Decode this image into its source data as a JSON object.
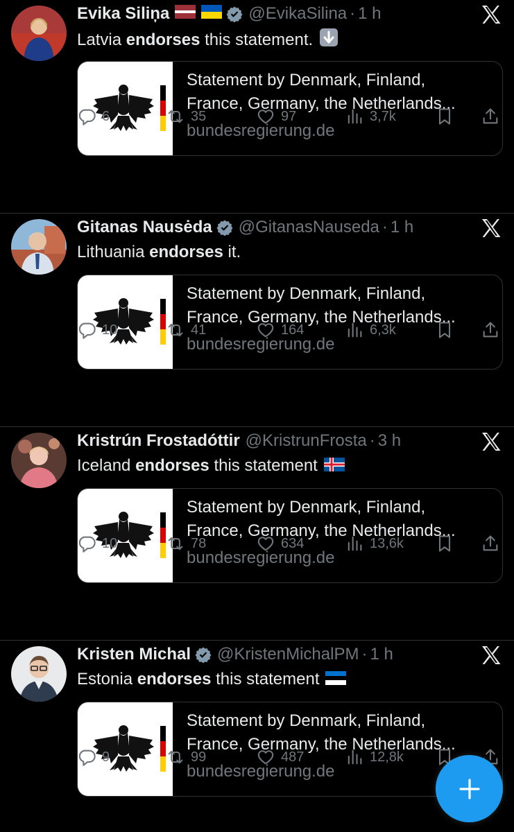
{
  "tweets": [
    {
      "name": "Evika Siliņa",
      "handle": "@EvikaSilina",
      "dot": "·",
      "time": "1 h",
      "flags": [
        "latvia",
        "ukraine"
      ],
      "verified": "gray",
      "text_pre": "Latvia ",
      "text_bold": "endorses",
      "text_post": " this statement. ",
      "emoji": "down-arrow",
      "card": {
        "title_line1": "Statement by Denmark, Finland,",
        "title_line2": "France, Germany, the Netherlands...",
        "domain": "bundesregierung.de"
      },
      "replies": "6",
      "reposts": "35",
      "likes": "97",
      "views": "3,7k"
    },
    {
      "name": "Gitanas Nausėda",
      "handle": "@GitanasNauseda",
      "dot": "·",
      "time": "1 h",
      "flags": [],
      "verified": "gray",
      "text_pre": "Lithuania ",
      "text_bold": "endorses",
      "text_post": " it.",
      "emoji": "",
      "card": {
        "title_line1": "Statement by Denmark, Finland,",
        "title_line2": "France, Germany, the Netherlands...",
        "domain": "bundesregierung.de"
      },
      "replies": "10",
      "reposts": "41",
      "likes": "164",
      "views": "6,3k"
    },
    {
      "name": "Kristrún Frostadóttir",
      "handle": "@KristrunFrosta",
      "dot": "·",
      "time": "3 h",
      "flags": [],
      "verified": "",
      "text_pre": "Iceland ",
      "text_bold": "endorses",
      "text_post": " this statement ",
      "emoji": "iceland-flag",
      "card": {
        "title_line1": "Statement by Denmark, Finland,",
        "title_line2": "France, Germany, the Netherlands...",
        "domain": "bundesregierung.de"
      },
      "replies": "10",
      "reposts": "78",
      "likes": "634",
      "views": "13,6k"
    },
    {
      "name": "Kristen Michal",
      "handle": "@KristenMichalPM",
      "dot": "·",
      "time": "1 h",
      "flags": [],
      "verified": "gray",
      "text_pre": "Estonia ",
      "text_bold": "endorses",
      "text_post": " this statement ",
      "emoji": "estonia-flag",
      "card": {
        "title_line1": "Statement by Denmark, Finland,",
        "title_line2": "France, Germany, the Netherlands...",
        "domain": "bundesregierung.de"
      },
      "replies": "9",
      "reposts": "99",
      "likes": "487",
      "views": "12,8k"
    }
  ],
  "colors": {
    "background": "#000000",
    "text": "#e7e9ea",
    "muted": "#71767b",
    "border": "#2f3336",
    "accent": "#1d9bf0"
  },
  "fab": {
    "icon": "plus-icon"
  }
}
